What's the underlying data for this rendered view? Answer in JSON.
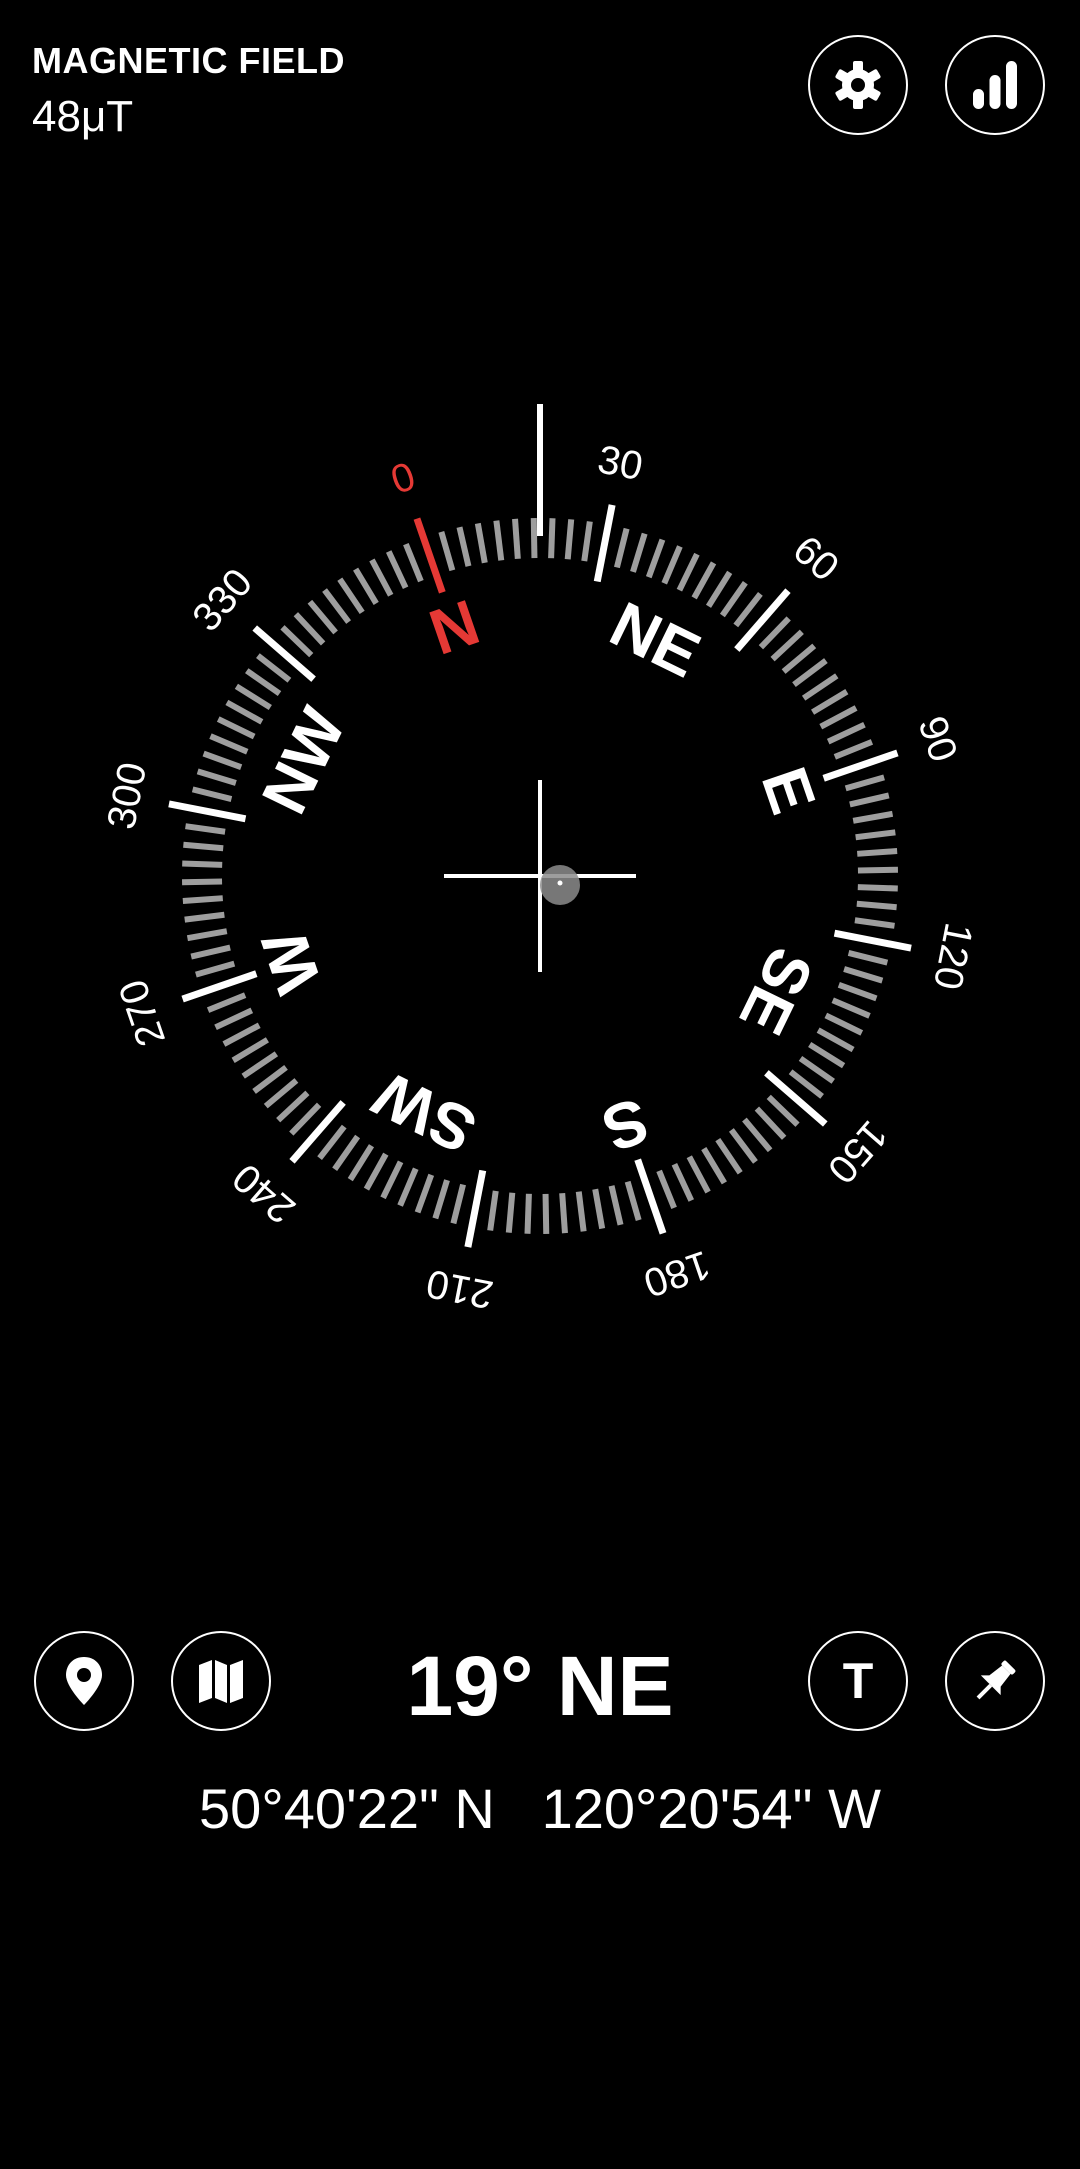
{
  "header": {
    "field_label": "MAGNETIC FIELD",
    "field_value": "48μT",
    "settings_icon": "gear-icon",
    "stats_icon": "signal-bars-icon"
  },
  "compass": {
    "heading_degrees": 19,
    "degree_labels": [
      "0",
      "30",
      "60",
      "90",
      "120",
      "150",
      "180",
      "210",
      "240",
      "270",
      "300",
      "330"
    ],
    "direction_labels": [
      "N",
      "NE",
      "E",
      "SE",
      "S",
      "SW",
      "W",
      "NW"
    ],
    "north_color": "#e53935",
    "tick_color": "#9e9e9e",
    "major_tick_color": "#ffffff"
  },
  "readout": {
    "heading_text": "19° NE",
    "latitude": "50°40'22\" N",
    "longitude": "120°20'54\" W"
  },
  "toolbar": {
    "location_icon": "location-pin-icon",
    "map_icon": "map-icon",
    "true_north_label": "T",
    "pin_icon": "pushpin-icon"
  }
}
